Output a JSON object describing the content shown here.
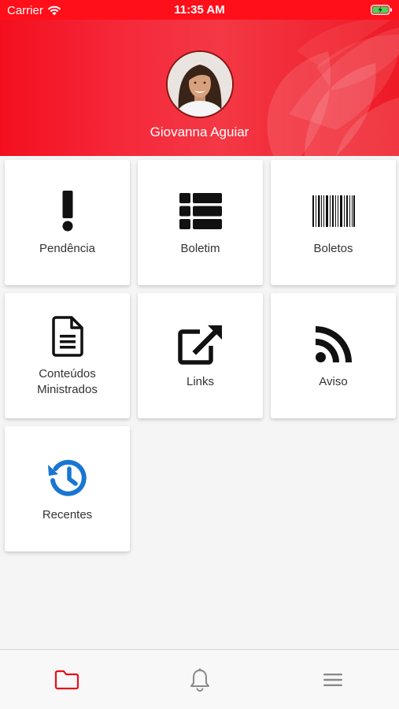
{
  "status_bar": {
    "carrier": "Carrier",
    "time": "11:35 AM",
    "wifi_icon": "wifi-icon",
    "battery_icon": "battery-charging-icon"
  },
  "header": {
    "user_name": "Giovanna Aguiar",
    "background_color": "#f0101e"
  },
  "menu": [
    {
      "label": "Pendência",
      "icon": "exclamation-icon"
    },
    {
      "label": "Boletim",
      "icon": "grid-list-icon"
    },
    {
      "label": "Boletos",
      "icon": "barcode-icon"
    },
    {
      "label": "Conteúdos Ministrados",
      "icon": "document-icon"
    },
    {
      "label": "Links",
      "icon": "external-link-icon"
    },
    {
      "label": "Aviso",
      "icon": "rss-icon"
    },
    {
      "label": "Recentes",
      "icon": "history-icon",
      "icon_color": "#1976d2"
    }
  ],
  "bottom_nav": [
    {
      "icon": "folder-icon",
      "active": true,
      "color": "#e8101c"
    },
    {
      "icon": "bell-icon",
      "active": false,
      "color": "#8a8a8a"
    },
    {
      "icon": "menu-icon",
      "active": false,
      "color": "#8a8a8a"
    }
  ]
}
